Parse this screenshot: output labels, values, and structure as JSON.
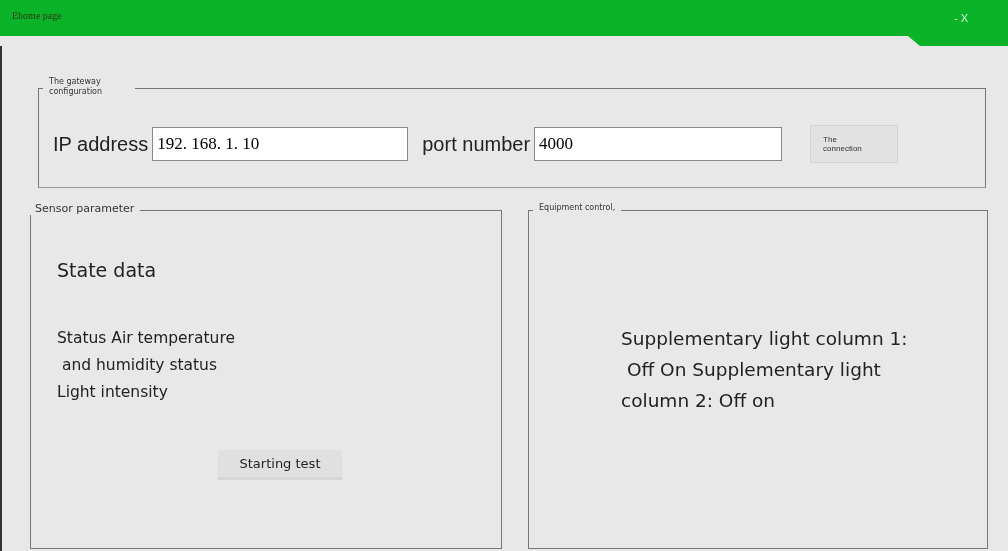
{
  "window": {
    "title": "Ehome page",
    "controls": "- X"
  },
  "gateway": {
    "legend": "The gateway configuration",
    "ip_label": "IP address",
    "ip_value": "192. 168. 1. 10",
    "port_label": "port number",
    "port_value": "4000",
    "connect_button": "The connection"
  },
  "sensor": {
    "legend": "Sensor parameter",
    "heading": "State data",
    "lines": [
      "Status Air temperature",
      " and humidity status",
      "Light intensity"
    ],
    "button": "Starting test"
  },
  "equipment": {
    "legend": "Equipment control,",
    "lines": [
      "Supplementary light column 1:",
      " Off On Supplementary light",
      "column 2: Off on"
    ]
  }
}
